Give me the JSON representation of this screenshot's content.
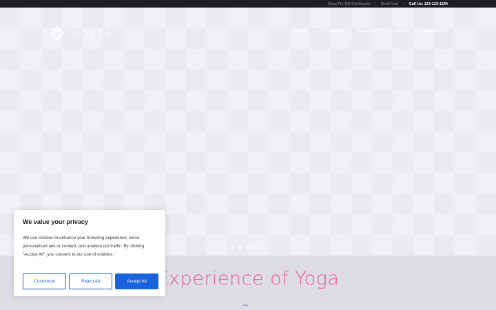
{
  "topbar": {
    "gift_link": "Shop For Gift Certificates",
    "book_link": "Book Now",
    "call": "Call Us: 123-123-1234"
  },
  "logo": {
    "text": "Yoga Fit"
  },
  "nav": {
    "items": [
      "HOME",
      "CLASSES",
      "LAYOUTS",
      "SHOP",
      "CONTACTS"
    ]
  },
  "slider": {
    "active_index": 1,
    "count": 5
  },
  "section": {
    "title": "Experience of Yoga",
    "divider": "~"
  },
  "cookie": {
    "title": "We value your privacy",
    "body": "We use cookies to enhance your browsing experience, serve personalised ads or content, and analyse our traffic. By clicking \"Accept All\", you consent to our use of cookies.",
    "customise": "Customise",
    "reject": "Reject All",
    "accept": "Accept All"
  },
  "colors": {
    "accent_pink": "#e45c9d",
    "button_blue": "#1863dc",
    "topbar_bg": "#1f1d21"
  }
}
